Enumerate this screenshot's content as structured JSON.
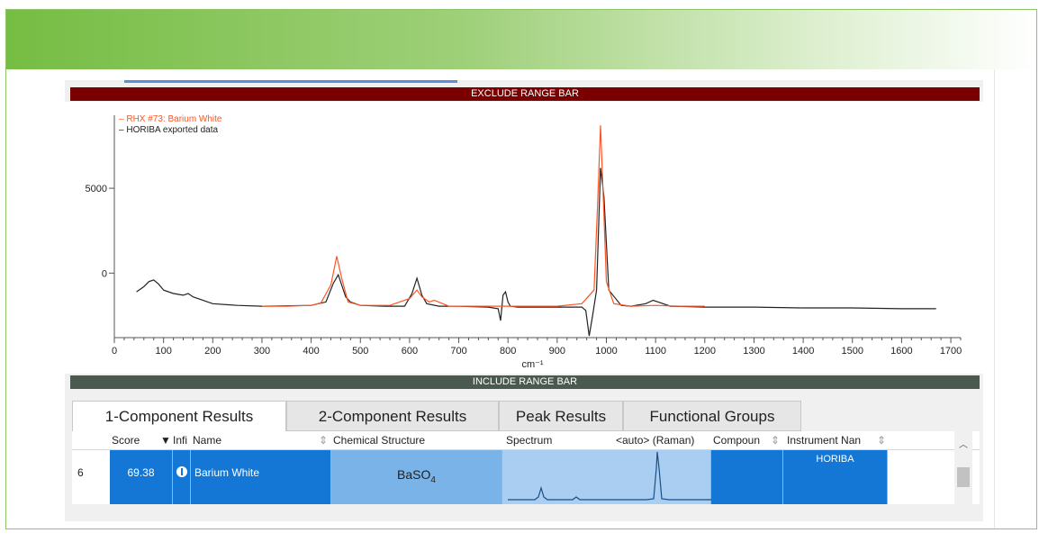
{
  "app": {
    "exclude_bar_label": "EXCLUDE RANGE BAR",
    "include_bar_label": "INCLUDE RANGE BAR"
  },
  "chart_data": {
    "type": "line",
    "xlabel": "cm⁻¹",
    "xlim": [
      0,
      1720
    ],
    "ylim": [
      -3800,
      9300
    ],
    "x_ticks": [
      0,
      100,
      200,
      300,
      400,
      500,
      600,
      700,
      800,
      900,
      1000,
      1100,
      1200,
      1300,
      1400,
      1500,
      1600,
      1700
    ],
    "y_ticks": [
      0,
      5000
    ],
    "grid": false,
    "legend_position": "top-left",
    "series": [
      {
        "name": "RHX #73: Barium White",
        "color": "#ff5522",
        "x": [
          300,
          350,
          400,
          420,
          440,
          452,
          462,
          475,
          500,
          560,
          600,
          615,
          625,
          640,
          650,
          680,
          750,
          800,
          900,
          950,
          975,
          982,
          988,
          993,
          1000,
          1015,
          1050,
          1100,
          1150,
          1200
        ],
        "y": [
          -1950,
          -1950,
          -1900,
          -1750,
          -700,
          1000,
          -300,
          -1700,
          -1900,
          -1900,
          -1500,
          -1000,
          -1400,
          -1700,
          -1600,
          -1950,
          -1950,
          -1950,
          -1950,
          -1800,
          -1000,
          4000,
          8700,
          5000,
          -500,
          -1800,
          -1950,
          -1900,
          -1950,
          -1950
        ]
      },
      {
        "name": "HORIBA exported data",
        "color": "#222222",
        "x": [
          45,
          60,
          70,
          80,
          90,
          100,
          120,
          140,
          150,
          160,
          200,
          250,
          300,
          400,
          430,
          445,
          455,
          470,
          480,
          500,
          550,
          590,
          605,
          615,
          625,
          635,
          660,
          700,
          760,
          780,
          785,
          790,
          795,
          800,
          805,
          820,
          900,
          950,
          958,
          965,
          972,
          980,
          988,
          995,
          1005,
          1030,
          1050,
          1080,
          1095,
          1110,
          1130,
          1200,
          1300,
          1400,
          1500,
          1600,
          1670
        ],
        "y": [
          -1100,
          -800,
          -500,
          -400,
          -650,
          -1000,
          -1200,
          -1300,
          -1200,
          -1400,
          -1800,
          -1900,
          -1950,
          -1900,
          -1700,
          -600,
          -100,
          -1400,
          -1700,
          -1900,
          -1950,
          -1950,
          -1200,
          -300,
          -1300,
          -1800,
          -1950,
          -1950,
          -2000,
          -2100,
          -2800,
          -1300,
          -1100,
          -1700,
          -1950,
          -2000,
          -2000,
          -2000,
          -2200,
          -3700,
          -2500,
          -1000,
          6200,
          4500,
          -1000,
          -1900,
          -1950,
          -1800,
          -1600,
          -1750,
          -1950,
          -2000,
          -2000,
          -2050,
          -2050,
          -2100,
          -2100
        ]
      }
    ]
  },
  "tabs": [
    {
      "label": "1-Component Results",
      "active": true
    },
    {
      "label": "2-Component Results",
      "active": false
    },
    {
      "label": "Peak Results",
      "active": false
    },
    {
      "label": "Functional Groups",
      "active": false
    }
  ],
  "columns": {
    "score": "Score",
    "info": "Infi",
    "name": "Name",
    "chem": "Chemical Structure",
    "spectrum": "Spectrum",
    "spectrum_auto": "<auto> (Raman)",
    "compound": "Compoun",
    "instrument": "Instrument Nan"
  },
  "result_row": {
    "index": "6",
    "score": "69.38",
    "info_icon": "info-icon",
    "name": "Barium White",
    "chem_base": "BaSO",
    "chem_sub": "4",
    "instrument": "HORIBA"
  },
  "colors": {
    "selection": "#1477d6",
    "exclude_bar": "#7a0000",
    "include_bar": "#4a5a4e",
    "banner_green": "#76bd43"
  }
}
